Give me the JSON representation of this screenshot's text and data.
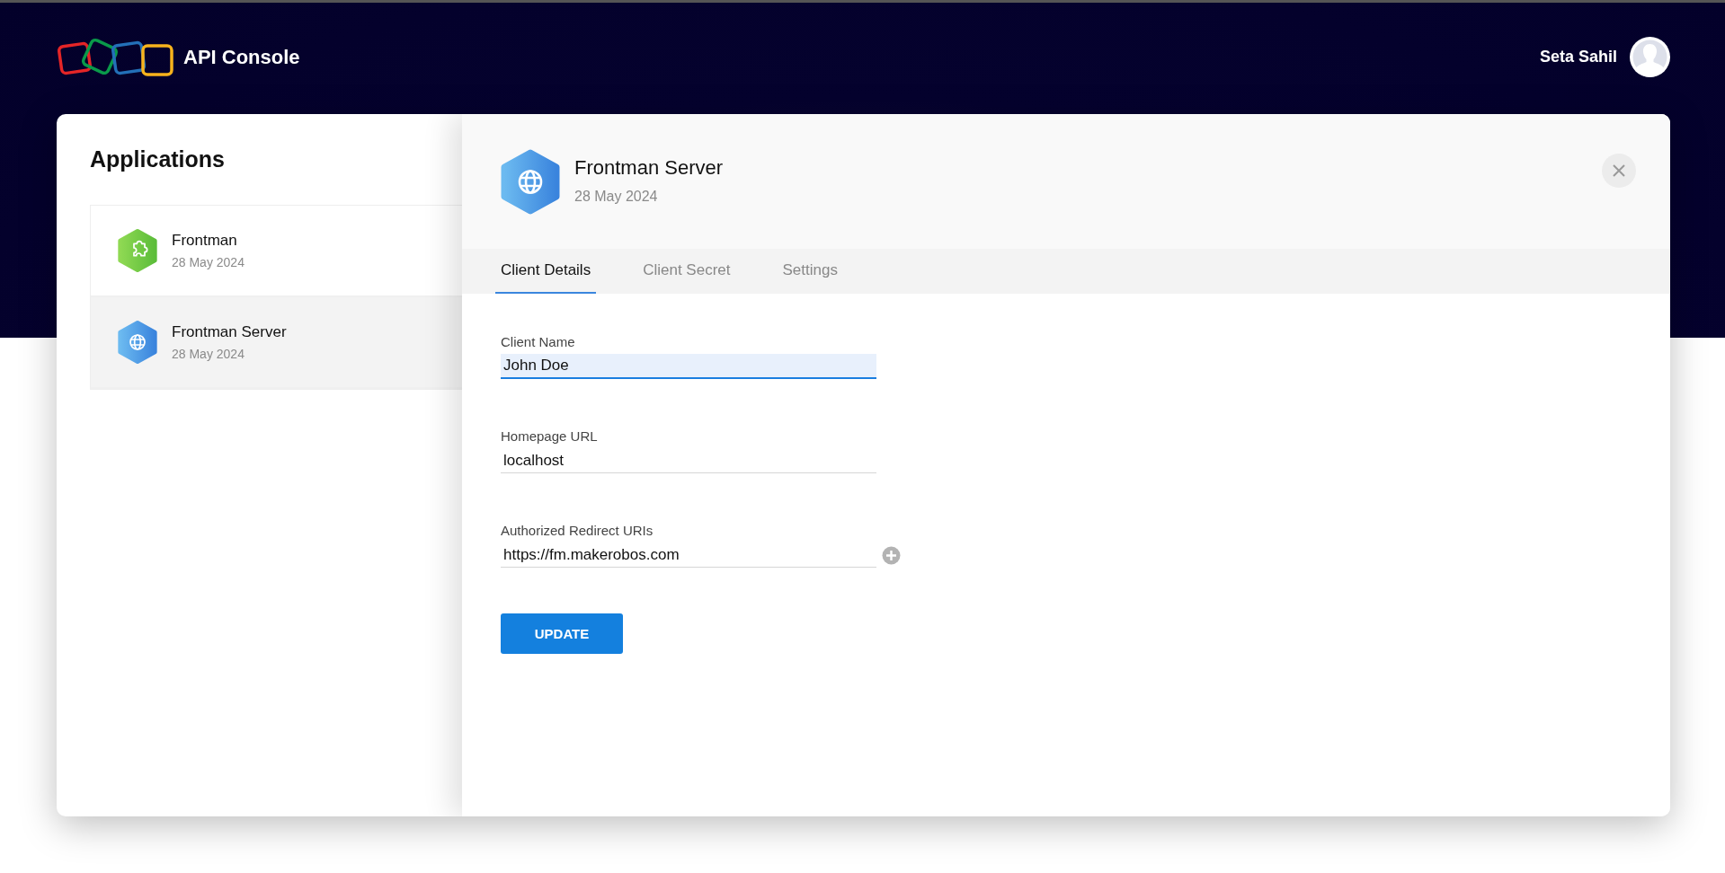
{
  "header": {
    "title": "API Console",
    "user_name": "Seta Sahil"
  },
  "applications": {
    "title": "Applications",
    "items": [
      {
        "name": "Frontman",
        "date": "28 May 2024",
        "kind": "puzzle",
        "selected": false
      },
      {
        "name": "Frontman Server",
        "date": "28 May 2024",
        "kind": "globe",
        "selected": true
      }
    ]
  },
  "detail": {
    "title": "Frontman Server",
    "date": "28 May 2024",
    "kind": "globe",
    "tabs": [
      {
        "label": "Client Details",
        "selected": true
      },
      {
        "label": "Client Secret",
        "selected": false
      },
      {
        "label": "Settings",
        "selected": false
      }
    ],
    "fields": [
      {
        "label": "Client Name",
        "value": "John Doe",
        "focused": true,
        "addable": false
      },
      {
        "label": "Homepage URL",
        "value": "localhost",
        "focused": false,
        "addable": false
      },
      {
        "label": "Authorized Redirect URIs",
        "value": "https://fm.makerobos.com",
        "focused": false,
        "addable": true
      }
    ],
    "button": "UPDATE"
  }
}
